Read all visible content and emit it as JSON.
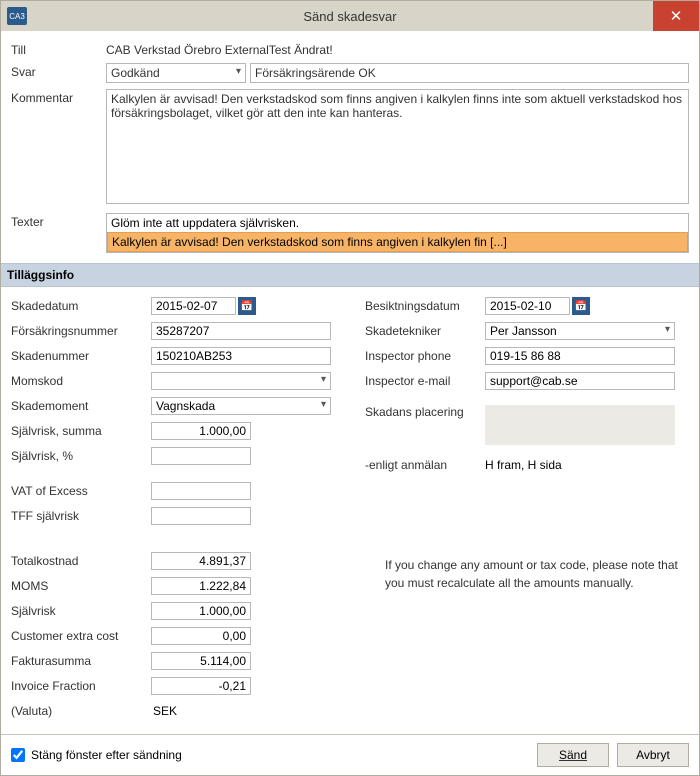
{
  "titlebar": {
    "icon_text": "CA3",
    "title": "Sänd skadesvar"
  },
  "header": {
    "till_label": "Till",
    "till_value": "CAB Verkstad Örebro ExternalTest Ändrat!",
    "svar_label": "Svar",
    "svar_value": "Godkänd",
    "svar_subject": "Försäkringsärende OK",
    "kommentar_label": "Kommentar",
    "kommentar_value": "Kalkylen är avvisad! Den verkstadskod som finns angiven i kalkylen finns inte som aktuell verkstadskod hos försäkringsbolaget, vilket gör att den inte kan hanteras.",
    "texter_label": "Texter",
    "texter_item1": "Glöm inte att uppdatera självrisken.",
    "texter_item2": "Kalkylen är avvisad! Den verkstadskod som finns angiven i kalkylen fin [...]"
  },
  "section_title": "Tilläggsinfo",
  "left": {
    "skadedatum_label": "Skadedatum",
    "skadedatum_value": "2015-02-07",
    "forsnr_label": "Försäkringsnummer",
    "forsnr_value": "35287207",
    "skadenummer_label": "Skadenummer",
    "skadenummer_value": "150210AB253",
    "momskod_label": "Momskod",
    "momskod_value": "",
    "skademoment_label": "Skademoment",
    "skademoment_value": "Vagnskada",
    "sjalvrisk_summa_label": "Självrisk, summa",
    "sjalvrisk_summa_value": "1.000,00",
    "sjalvrisk_pct_label": "Självrisk, %",
    "sjalvrisk_pct_value": "",
    "vat_excess_label": "VAT of Excess",
    "vat_excess_value": "",
    "tff_label": "TFF självrisk",
    "tff_value": "",
    "totalkostnad_label": "Totalkostnad",
    "totalkostnad_value": "4.891,37",
    "moms_label": "MOMS",
    "moms_value": "1.222,84",
    "sjalvrisk_label": "Självrisk",
    "sjalvrisk_value": "1.000,00",
    "custextra_label": "Customer extra cost",
    "custextra_value": "0,00",
    "fakturasumma_label": "Fakturasumma",
    "fakturasumma_value": "5.114,00",
    "invfrac_label": "Invoice Fraction",
    "invfrac_value": "-0,21",
    "valuta_label": "(Valuta)",
    "valuta_value": "SEK"
  },
  "right": {
    "besikt_label": "Besiktningsdatum",
    "besikt_value": "2015-02-10",
    "skadetekniker_label": "Skadetekniker",
    "skadetekniker_value": "Per Jansson",
    "phone_label": "Inspector phone",
    "phone_value": "019-15 86 88",
    "email_label": "Inspector e-mail",
    "email_value": "support@cab.se",
    "placering_label": "Skadans placering",
    "anmalan_label": "-enligt anmälan",
    "anmalan_value": "H fram, H sida",
    "note": "If you change any amount or tax code, please note that you must recalculate all the amounts manually."
  },
  "footer": {
    "close_checkbox": "Stäng fönster efter sändning",
    "send": "Sänd",
    "cancel": "Avbryt"
  }
}
